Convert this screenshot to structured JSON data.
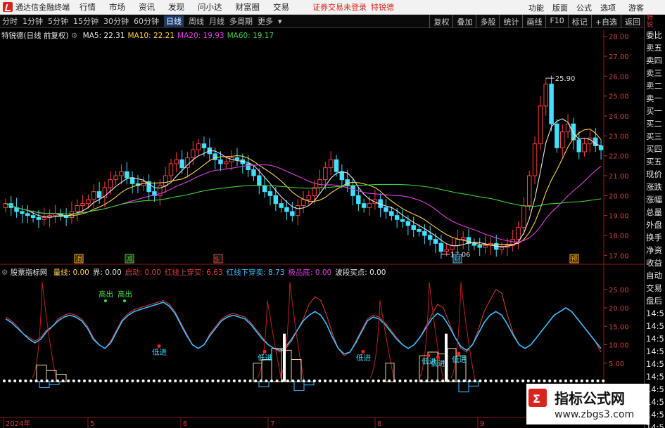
{
  "menubar": {
    "app_title": "通达信金融终端",
    "items": [
      "行情",
      "市场",
      "资讯",
      "发现",
      "问小达",
      "财富圈",
      "交易"
    ],
    "login_notice": "证券交易未登录",
    "stock_name": "特锐德",
    "right_items": [
      "功能",
      "版面",
      "公式",
      "选项"
    ],
    "guest_label": "游客"
  },
  "toolbar": {
    "periods": [
      "分时",
      "1分钟",
      "5分钟",
      "15分钟",
      "30分钟",
      "60分钟",
      "日线",
      "周线",
      "月线",
      "多周期",
      "更多"
    ],
    "active_period": "日线",
    "tools": [
      "复权",
      "叠加",
      "多股",
      "统计",
      "画线",
      "F10",
      "标记",
      "+自选",
      "返回"
    ]
  },
  "main_chart": {
    "stock_label": "特锐德(日线 前复权)",
    "ma_labels": [
      {
        "text": "MA5: 22.31",
        "color": "#e8e8e8"
      },
      {
        "text": "MA10: 22.21",
        "color": "#ffd24a"
      },
      {
        "text": "MA20: 19.93",
        "color": "#e040e0"
      },
      {
        "text": "MA60: 19.17",
        "color": "#40d040"
      }
    ],
    "high_label": "25.90",
    "low_label": "17.06",
    "bottom_markers": [
      {
        "text": "消",
        "color": "#ffb000"
      },
      {
        "text": "减",
        "color": "#40d040"
      },
      {
        "text": "$",
        "color": "#e04040"
      },
      {
        "text": "财",
        "color": "#40c0ff"
      },
      {
        "text": "预",
        "color": "#ffb000"
      }
    ]
  },
  "indicator": {
    "title": "股票指标网",
    "values": [
      {
        "text": "量线: 0.00",
        "color": "#ffd24a"
      },
      {
        "text": "界: 0.00",
        "color": "#e8e8e8"
      },
      {
        "text": "启动: 0.00",
        "color": "#e04040"
      },
      {
        "text": "红线上穿买: 6.63",
        "color": "#e04040"
      },
      {
        "text": "红线下穿卖: 8.73",
        "color": "#40c0ff"
      },
      {
        "text": "极品底: 0.00",
        "color": "#e040e0"
      },
      {
        "text": "波段买点: 0.00",
        "color": "#e8e8e8"
      }
    ],
    "annotations": {
      "high_out": "高出",
      "low_in": "低进"
    }
  },
  "date_axis": [
    "2024年",
    "5",
    "6",
    "7",
    "8",
    "9"
  ],
  "right_column": {
    "top_label": "特\n锐",
    "items": [
      "委比",
      "卖五",
      "卖四",
      "卖三",
      "卖二",
      "卖一",
      "买一",
      "买二",
      "买三",
      "买四",
      "买五",
      "现价",
      "涨跌",
      "涨幅",
      "总量",
      "外盘",
      "换手",
      "净资",
      "收益",
      "自动",
      "交易",
      "盘后",
      "14:5",
      "14:5",
      "14:5",
      "14:5",
      "14:5",
      "14:5",
      "14:5",
      "14:5",
      "14:5",
      "14:5"
    ]
  },
  "watermark": {
    "title": "指标公式网",
    "url": "www.zbgs3.com"
  },
  "chart_data": [
    {
      "type": "candlestick",
      "title": "特锐德(日线 前复权)",
      "y_axis": {
        "ticks": [
          17.0,
          18.0,
          19.0,
          20.0,
          21.0,
          22.0,
          23.0,
          24.0,
          25.0,
          26.0,
          27.0,
          28.0
        ],
        "ylim": [
          16.8,
          28.2
        ]
      },
      "x_axis": {
        "months": [
          "2024年",
          "5",
          "6",
          "7",
          "8",
          "9"
        ]
      },
      "series_points": [
        19.6,
        19.4,
        19.2,
        19.1,
        19.0,
        18.9,
        18.8,
        18.9,
        19.0,
        19.1,
        19.0,
        18.9,
        19.2,
        19.5,
        19.6,
        19.8,
        20.2,
        19.9,
        20.4,
        20.8,
        21.0,
        21.2,
        20.9,
        20.6,
        20.5,
        20.7,
        20.2,
        20.0,
        20.5,
        21.0,
        21.6,
        21.8,
        21.4,
        21.9,
        22.3,
        22.6,
        22.4,
        22.1,
        21.8,
        21.6,
        21.7,
        21.9,
        21.8,
        21.6,
        21.3,
        21.0,
        20.5,
        20.2,
        20.0,
        19.6,
        19.4,
        19.2,
        19.0,
        19.5,
        19.8,
        20.0,
        20.4,
        20.8,
        21.4,
        21.8,
        21.2,
        20.8,
        20.5,
        20.0,
        19.6,
        19.4,
        19.6,
        19.8,
        19.4,
        19.2,
        19.0,
        18.8,
        18.7,
        18.5,
        18.3,
        18.2,
        18.0,
        17.8,
        17.6,
        17.2,
        17.3,
        17.5,
        17.8,
        17.9,
        17.6,
        17.5,
        17.4,
        17.5,
        17.6,
        17.3,
        17.4,
        17.5,
        17.8,
        18.4,
        19.5,
        21.0,
        22.6,
        24.5,
        25.6,
        23.6,
        22.4,
        23.2,
        23.6,
        22.8,
        22.2,
        22.6,
        22.9,
        22.5,
        22.3
      ],
      "ma_series": [
        {
          "name": "MA5",
          "color": "#e8e8e8",
          "last": 22.31
        },
        {
          "name": "MA10",
          "color": "#ffd24a",
          "last": 22.21
        },
        {
          "name": "MA20",
          "color": "#e040e0",
          "last": 19.93
        },
        {
          "name": "MA60",
          "color": "#40d040",
          "last": 19.17
        }
      ],
      "annotations": [
        {
          "text": "25.90",
          "value": 25.9
        },
        {
          "text": "17.06",
          "value": 17.06
        }
      ]
    },
    {
      "type": "line",
      "title": "股票指标网",
      "y_axis": {
        "ticks": [
          5.0,
          10.0,
          15.0,
          20.0,
          25.0
        ],
        "ylim": [
          0,
          28
        ]
      },
      "series": [
        {
          "name": "红线",
          "color": "#e04040",
          "values": [
            17.5,
            16.5,
            15,
            13,
            12,
            11,
            12,
            14,
            15,
            17,
            18,
            18.5,
            18,
            17,
            15,
            12,
            10,
            9,
            11,
            14,
            17,
            18.5,
            19.5,
            20,
            20.5,
            21,
            21.5,
            22,
            21,
            19,
            16,
            13,
            10,
            9,
            10,
            13,
            15,
            17,
            18,
            18.5,
            18,
            17.5,
            16,
            14,
            12,
            10,
            9,
            8,
            9,
            11,
            14,
            17,
            21,
            23,
            22,
            18,
            13,
            9,
            7,
            8,
            11,
            14,
            17,
            18,
            17.5,
            16,
            14,
            12,
            10,
            9,
            10,
            12,
            15,
            18,
            21,
            20,
            16,
            12,
            9,
            8,
            10,
            14,
            19,
            22,
            25,
            24,
            18,
            13,
            10,
            9,
            10,
            12,
            14,
            16,
            18,
            19,
            20,
            19,
            17,
            15,
            13,
            11,
            8
          ]
        },
        {
          "name": "蓝线",
          "color": "#40c0ff",
          "values": [
            17,
            16,
            14.5,
            13,
            11.5,
            10.5,
            11.5,
            13.5,
            15,
            16.5,
            17.5,
            18,
            17.5,
            16.5,
            14.5,
            11.5,
            10,
            9,
            10.5,
            13.5,
            16.5,
            18,
            19,
            19.5,
            20,
            20.5,
            21,
            21.5,
            20.5,
            18.5,
            15.5,
            12.5,
            10,
            9,
            10,
            12.5,
            14.5,
            16.5,
            17.5,
            18,
            17.5,
            17,
            15.5,
            13.5,
            11.5,
            10,
            9,
            8.5,
            9.5,
            11.5,
            14,
            16.5,
            18,
            19,
            18,
            15.5,
            12,
            9,
            7.5,
            8,
            10.5,
            13.5,
            16.5,
            17.5,
            17,
            15.5,
            13.5,
            11.5,
            10,
            9,
            10,
            12,
            14.5,
            17,
            18.5,
            17.5,
            15,
            12,
            9.5,
            8.5,
            10,
            13,
            16,
            18,
            19,
            18,
            15.5,
            12.5,
            10,
            9,
            10,
            12,
            14,
            16,
            18,
            19,
            20,
            19,
            17,
            15,
            13,
            11,
            9
          ]
        }
      ],
      "annotations": [
        {
          "text": "高出",
          "count": 2
        },
        {
          "text": "低进",
          "count": 6
        }
      ]
    }
  ]
}
